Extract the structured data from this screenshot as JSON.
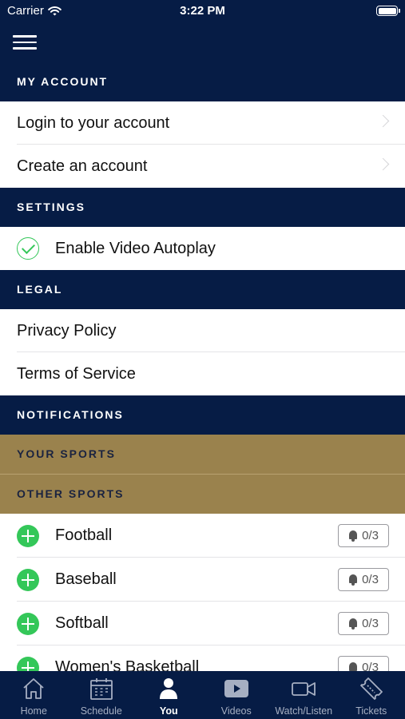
{
  "status_bar": {
    "carrier": "Carrier",
    "time": "3:22 PM"
  },
  "sections": {
    "my_account": "MY ACCOUNT",
    "settings": "SETTINGS",
    "legal": "LEGAL",
    "notifications": "NOTIFICATIONS",
    "your_sports": "YOUR SPORTS",
    "other_sports": "OTHER SPORTS"
  },
  "account": {
    "login": "Login to your account",
    "create": "Create an account"
  },
  "settings": {
    "autoplay": "Enable Video Autoplay"
  },
  "legal": {
    "privacy": "Privacy Policy",
    "terms": "Terms of Service"
  },
  "sports": [
    {
      "name": "Football",
      "count": "0/3"
    },
    {
      "name": "Baseball",
      "count": "0/3"
    },
    {
      "name": "Softball",
      "count": "0/3"
    },
    {
      "name": "Women's Basketball",
      "count": "0/3"
    }
  ],
  "tabs": [
    {
      "label": "Home",
      "icon": "home-icon"
    },
    {
      "label": "Schedule",
      "icon": "calendar-icon"
    },
    {
      "label": "You",
      "icon": "person-icon",
      "active": true
    },
    {
      "label": "Videos",
      "icon": "play-icon"
    },
    {
      "label": "Watch/Listen",
      "icon": "video-camera-icon"
    },
    {
      "label": "Tickets",
      "icon": "ticket-icon"
    }
  ],
  "colors": {
    "navy": "#061c45",
    "gold": "#9a824d",
    "green": "#34c759"
  }
}
